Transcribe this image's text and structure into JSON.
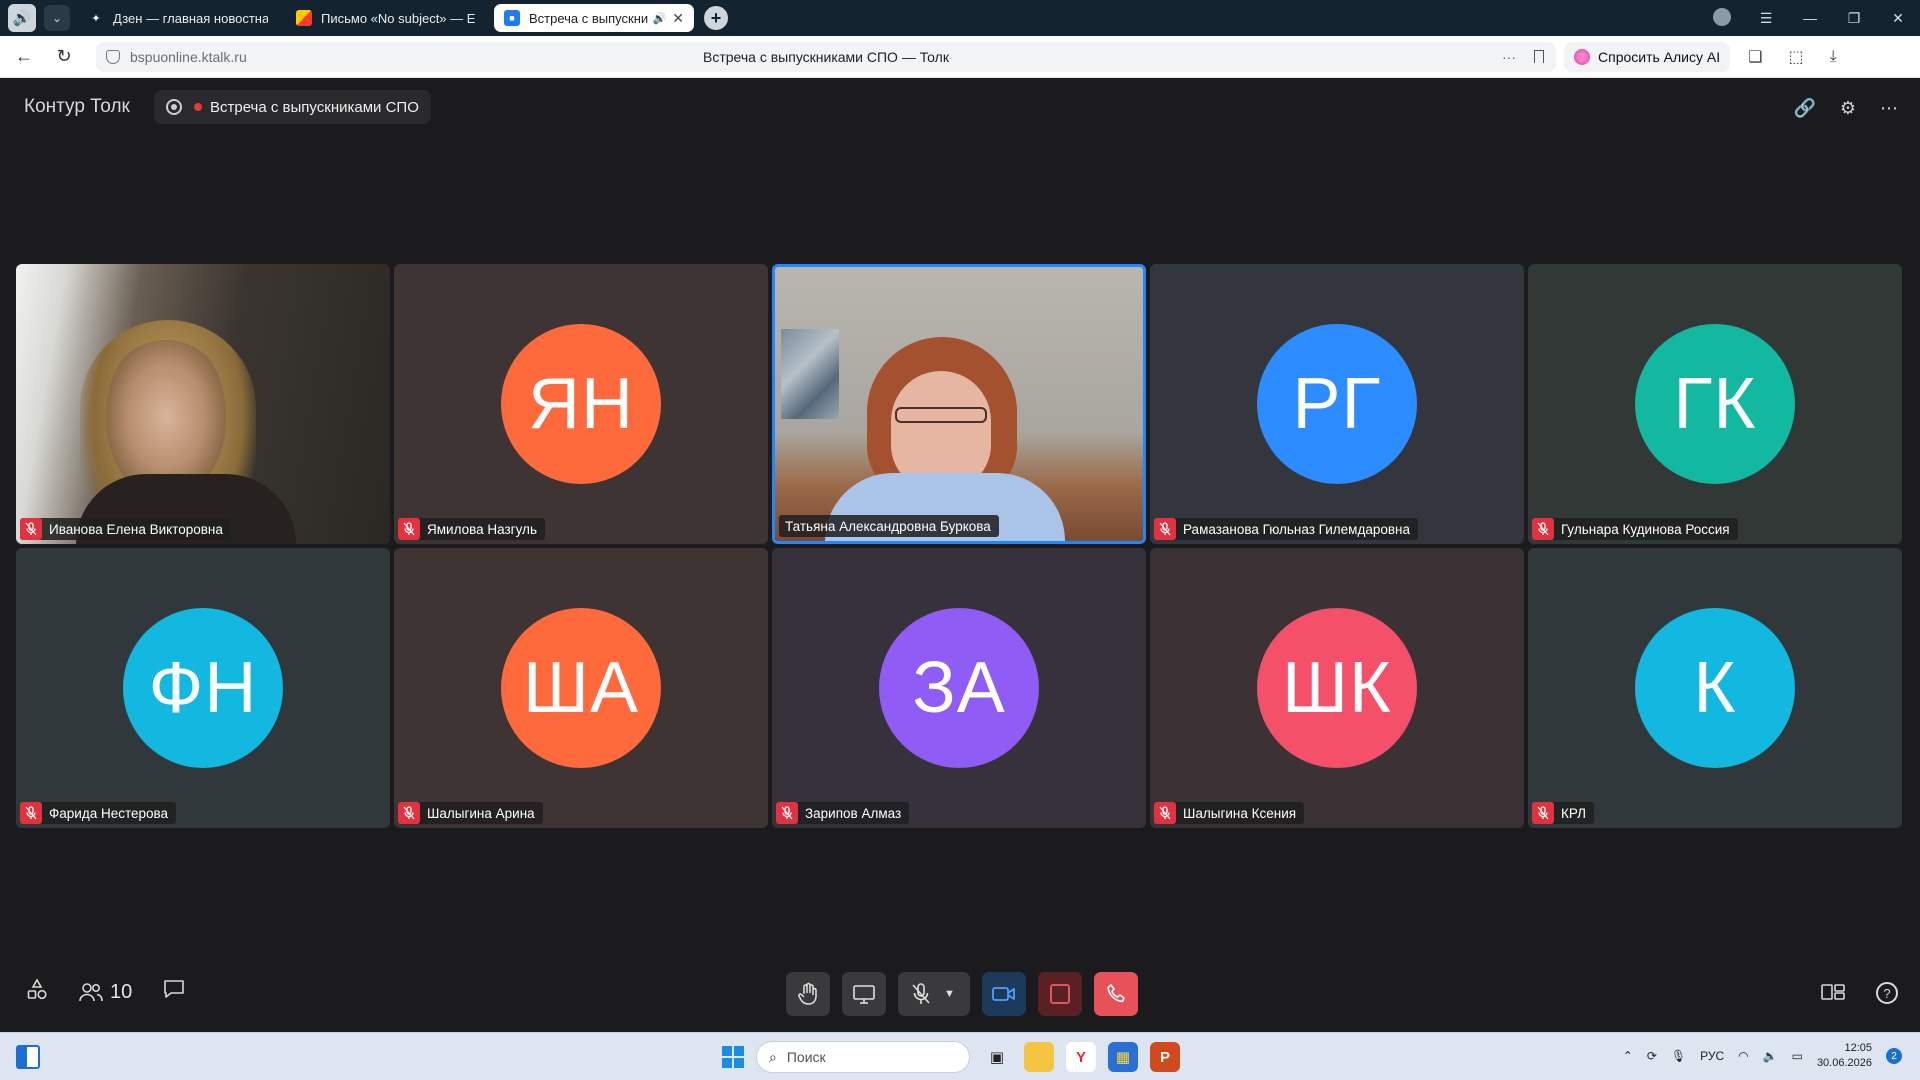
{
  "browser": {
    "tabs": [
      {
        "label": "Дзен — главная новостна",
        "icon": "dzen-icon"
      },
      {
        "label": "Письмо «No subject» — Е",
        "icon": "mail-icon"
      },
      {
        "label": "Встреча с выпускни",
        "icon": "video-icon",
        "active": true
      }
    ],
    "url": "bspuonline.ktalk.ru",
    "page_title": "Встреча с выпускниками СПО — Толк",
    "alice_label": "Спросить Алису AI"
  },
  "app": {
    "brand": "Контур Толк",
    "meeting_title": "Встреча с выпускниками СПО"
  },
  "participants": [
    {
      "name": "Иванова Елена Викторовна",
      "type": "video1",
      "muted": true
    },
    {
      "name": "Ямилова Назгуль",
      "initials": "ЯН",
      "avatar_color": "#ff6a3d",
      "tile_bg": "#3d3433",
      "muted": true
    },
    {
      "name": "Татьяна Александровна Буркова",
      "type": "video2",
      "muted": false,
      "active": true
    },
    {
      "name": "Рамазанова Гюльназ Гилемдаровна",
      "initials": "РГ",
      "avatar_color": "#2d8cff",
      "tile_bg": "#33373d",
      "muted": true
    },
    {
      "name": "Гульнара Кудинова Россия",
      "initials": "ГК",
      "avatar_color": "#12b8a0",
      "tile_bg": "#323836",
      "muted": true
    },
    {
      "name": "Фарида Нестерова",
      "initials": "ФН",
      "avatar_color": "#12b8e0",
      "tile_bg": "#30383b",
      "muted": true
    },
    {
      "name": "Шалыгина Арина",
      "initials": "ША",
      "avatar_color": "#ff6a3d",
      "tile_bg": "#3d3433",
      "muted": true
    },
    {
      "name": "Зарипов Алмаз",
      "initials": "ЗА",
      "avatar_color": "#8f5cf5",
      "tile_bg": "#35323c",
      "muted": true
    },
    {
      "name": "Шалыгина Ксения",
      "initials": "ШК",
      "avatar_color": "#f5506a",
      "tile_bg": "#3b3235",
      "muted": true
    },
    {
      "name": "КРЛ",
      "initials": "К",
      "avatar_color": "#12b8e0",
      "tile_bg": "#30383b",
      "muted": true
    }
  ],
  "toolbar": {
    "participants_count": "10"
  },
  "taskbar": {
    "search_placeholder": "Поиск",
    "lang": "РУС",
    "time": "12:05",
    "date": "30.06.2026",
    "notifications": "2"
  }
}
